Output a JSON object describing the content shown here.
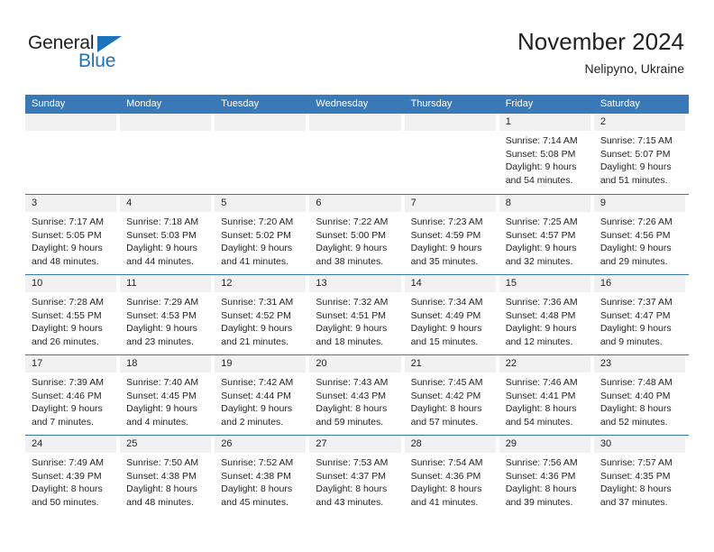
{
  "logo": {
    "word_one": "General",
    "word_two": "Blue",
    "triangle_icon": "triangle-icon",
    "brand_color": "#1b74bb"
  },
  "header": {
    "title": "November 2024",
    "subtitle": "Nelipyno, Ukraine"
  },
  "theme": {
    "header_blue": "#3a79b8",
    "band_gray": "#f1f1f1",
    "text": "#231f20"
  },
  "weekdays": [
    "Sunday",
    "Monday",
    "Tuesday",
    "Wednesday",
    "Thursday",
    "Friday",
    "Saturday"
  ],
  "weeks": [
    [
      {
        "day": "",
        "empty": true
      },
      {
        "day": "",
        "empty": true
      },
      {
        "day": "",
        "empty": true
      },
      {
        "day": "",
        "empty": true
      },
      {
        "day": "",
        "empty": true
      },
      {
        "day": "1",
        "sunrise": "Sunrise: 7:14 AM",
        "sunset": "Sunset: 5:08 PM",
        "daylight_1": "Daylight: 9 hours",
        "daylight_2": "and 54 minutes."
      },
      {
        "day": "2",
        "sunrise": "Sunrise: 7:15 AM",
        "sunset": "Sunset: 5:07 PM",
        "daylight_1": "Daylight: 9 hours",
        "daylight_2": "and 51 minutes."
      }
    ],
    [
      {
        "day": "3",
        "sunrise": "Sunrise: 7:17 AM",
        "sunset": "Sunset: 5:05 PM",
        "daylight_1": "Daylight: 9 hours",
        "daylight_2": "and 48 minutes."
      },
      {
        "day": "4",
        "sunrise": "Sunrise: 7:18 AM",
        "sunset": "Sunset: 5:03 PM",
        "daylight_1": "Daylight: 9 hours",
        "daylight_2": "and 44 minutes."
      },
      {
        "day": "5",
        "sunrise": "Sunrise: 7:20 AM",
        "sunset": "Sunset: 5:02 PM",
        "daylight_1": "Daylight: 9 hours",
        "daylight_2": "and 41 minutes."
      },
      {
        "day": "6",
        "sunrise": "Sunrise: 7:22 AM",
        "sunset": "Sunset: 5:00 PM",
        "daylight_1": "Daylight: 9 hours",
        "daylight_2": "and 38 minutes."
      },
      {
        "day": "7",
        "sunrise": "Sunrise: 7:23 AM",
        "sunset": "Sunset: 4:59 PM",
        "daylight_1": "Daylight: 9 hours",
        "daylight_2": "and 35 minutes."
      },
      {
        "day": "8",
        "sunrise": "Sunrise: 7:25 AM",
        "sunset": "Sunset: 4:57 PM",
        "daylight_1": "Daylight: 9 hours",
        "daylight_2": "and 32 minutes."
      },
      {
        "day": "9",
        "sunrise": "Sunrise: 7:26 AM",
        "sunset": "Sunset: 4:56 PM",
        "daylight_1": "Daylight: 9 hours",
        "daylight_2": "and 29 minutes."
      }
    ],
    [
      {
        "day": "10",
        "sunrise": "Sunrise: 7:28 AM",
        "sunset": "Sunset: 4:55 PM",
        "daylight_1": "Daylight: 9 hours",
        "daylight_2": "and 26 minutes."
      },
      {
        "day": "11",
        "sunrise": "Sunrise: 7:29 AM",
        "sunset": "Sunset: 4:53 PM",
        "daylight_1": "Daylight: 9 hours",
        "daylight_2": "and 23 minutes."
      },
      {
        "day": "12",
        "sunrise": "Sunrise: 7:31 AM",
        "sunset": "Sunset: 4:52 PM",
        "daylight_1": "Daylight: 9 hours",
        "daylight_2": "and 21 minutes."
      },
      {
        "day": "13",
        "sunrise": "Sunrise: 7:32 AM",
        "sunset": "Sunset: 4:51 PM",
        "daylight_1": "Daylight: 9 hours",
        "daylight_2": "and 18 minutes."
      },
      {
        "day": "14",
        "sunrise": "Sunrise: 7:34 AM",
        "sunset": "Sunset: 4:49 PM",
        "daylight_1": "Daylight: 9 hours",
        "daylight_2": "and 15 minutes."
      },
      {
        "day": "15",
        "sunrise": "Sunrise: 7:36 AM",
        "sunset": "Sunset: 4:48 PM",
        "daylight_1": "Daylight: 9 hours",
        "daylight_2": "and 12 minutes."
      },
      {
        "day": "16",
        "sunrise": "Sunrise: 7:37 AM",
        "sunset": "Sunset: 4:47 PM",
        "daylight_1": "Daylight: 9 hours",
        "daylight_2": "and 9 minutes."
      }
    ],
    [
      {
        "day": "17",
        "sunrise": "Sunrise: 7:39 AM",
        "sunset": "Sunset: 4:46 PM",
        "daylight_1": "Daylight: 9 hours",
        "daylight_2": "and 7 minutes."
      },
      {
        "day": "18",
        "sunrise": "Sunrise: 7:40 AM",
        "sunset": "Sunset: 4:45 PM",
        "daylight_1": "Daylight: 9 hours",
        "daylight_2": "and 4 minutes."
      },
      {
        "day": "19",
        "sunrise": "Sunrise: 7:42 AM",
        "sunset": "Sunset: 4:44 PM",
        "daylight_1": "Daylight: 9 hours",
        "daylight_2": "and 2 minutes."
      },
      {
        "day": "20",
        "sunrise": "Sunrise: 7:43 AM",
        "sunset": "Sunset: 4:43 PM",
        "daylight_1": "Daylight: 8 hours",
        "daylight_2": "and 59 minutes."
      },
      {
        "day": "21",
        "sunrise": "Sunrise: 7:45 AM",
        "sunset": "Sunset: 4:42 PM",
        "daylight_1": "Daylight: 8 hours",
        "daylight_2": "and 57 minutes."
      },
      {
        "day": "22",
        "sunrise": "Sunrise: 7:46 AM",
        "sunset": "Sunset: 4:41 PM",
        "daylight_1": "Daylight: 8 hours",
        "daylight_2": "and 54 minutes."
      },
      {
        "day": "23",
        "sunrise": "Sunrise: 7:48 AM",
        "sunset": "Sunset: 4:40 PM",
        "daylight_1": "Daylight: 8 hours",
        "daylight_2": "and 52 minutes."
      }
    ],
    [
      {
        "day": "24",
        "sunrise": "Sunrise: 7:49 AM",
        "sunset": "Sunset: 4:39 PM",
        "daylight_1": "Daylight: 8 hours",
        "daylight_2": "and 50 minutes."
      },
      {
        "day": "25",
        "sunrise": "Sunrise: 7:50 AM",
        "sunset": "Sunset: 4:38 PM",
        "daylight_1": "Daylight: 8 hours",
        "daylight_2": "and 48 minutes."
      },
      {
        "day": "26",
        "sunrise": "Sunrise: 7:52 AM",
        "sunset": "Sunset: 4:38 PM",
        "daylight_1": "Daylight: 8 hours",
        "daylight_2": "and 45 minutes."
      },
      {
        "day": "27",
        "sunrise": "Sunrise: 7:53 AM",
        "sunset": "Sunset: 4:37 PM",
        "daylight_1": "Daylight: 8 hours",
        "daylight_2": "and 43 minutes."
      },
      {
        "day": "28",
        "sunrise": "Sunrise: 7:54 AM",
        "sunset": "Sunset: 4:36 PM",
        "daylight_1": "Daylight: 8 hours",
        "daylight_2": "and 41 minutes."
      },
      {
        "day": "29",
        "sunrise": "Sunrise: 7:56 AM",
        "sunset": "Sunset: 4:36 PM",
        "daylight_1": "Daylight: 8 hours",
        "daylight_2": "and 39 minutes."
      },
      {
        "day": "30",
        "sunrise": "Sunrise: 7:57 AM",
        "sunset": "Sunset: 4:35 PM",
        "daylight_1": "Daylight: 8 hours",
        "daylight_2": "and 37 minutes."
      }
    ]
  ]
}
